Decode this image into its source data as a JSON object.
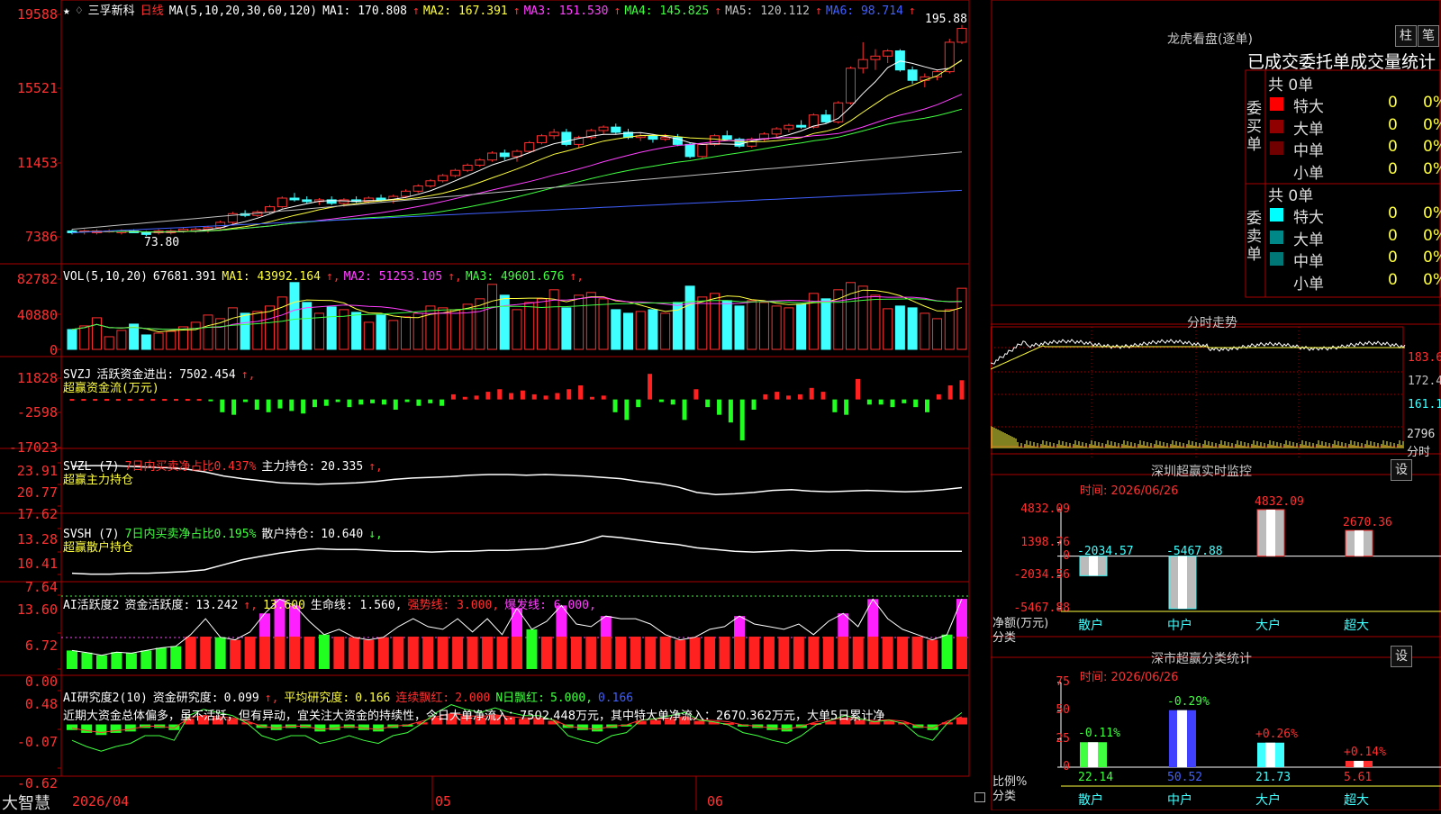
{
  "main": {
    "star": "★",
    "mark": "♢",
    "stock_name": "三孚新科",
    "period": "日线",
    "ma_label": "MA(5,10,20,30,60,120)",
    "ma": [
      {
        "name": "MA1:",
        "value": "170.808",
        "arrow": "↑",
        "color": "#ffffff"
      },
      {
        "name": "MA2:",
        "value": "167.391",
        "arrow": "↑",
        "color": "#ffff40"
      },
      {
        "name": "MA3:",
        "value": "151.530",
        "arrow": "↑",
        "color": "#ff40ff"
      },
      {
        "name": "MA4:",
        "value": "145.825",
        "arrow": "↑",
        "color": "#40ff40"
      },
      {
        "name": "MA5:",
        "value": "120.112",
        "arrow": "↑",
        "color": "#c0c0c0"
      },
      {
        "name": "MA6:",
        "value": "98.714",
        "arrow": "↑",
        "color": "#4060ff"
      }
    ],
    "price_axis": [
      "19588",
      "15521",
      "11453",
      "7386"
    ],
    "high_label": "195.88",
    "low_label": "73.80",
    "vol": {
      "label": "VOL(5,10,20)",
      "value": "67681.391",
      "ma": [
        {
          "name": "MA1:",
          "value": "43992.164",
          "color": "#ffff40"
        },
        {
          "name": "MA2:",
          "value": "51253.105",
          "color": "#ff40ff"
        },
        {
          "name": "MA3:",
          "value": "49601.676",
          "color": "#40ff40"
        }
      ],
      "axis": [
        "82782",
        "40880",
        "0"
      ]
    },
    "svzj": {
      "label": "SVZJ",
      "name": "活跃资金进出:",
      "value": "7502.454",
      "sub": "超赢资金流(万元)",
      "axis": [
        "11828",
        "-2598",
        "-17023"
      ]
    },
    "svzl": {
      "label": "SVZL (7)",
      "name1": "7日内买卖净占比0.437%",
      "name2": "主力持仓:",
      "value": "20.335",
      "sub": "超赢主力持仓",
      "axis": [
        "23.91",
        "20.77",
        "17.62"
      ]
    },
    "svsh": {
      "label": "SVSH (7)",
      "name1": "7日内买卖净占比0.195%",
      "name2": "散户持仓:",
      "value": "10.640",
      "sub": "超赢散户持仓",
      "axis": [
        "13.28",
        "10.41",
        "7.64"
      ]
    },
    "ai1": {
      "label": "AI活跃度2",
      "name": "资金活跃度:",
      "value": "13.242",
      "v2": "13.600",
      "life": "生命线: 1.560,",
      "strong": "强势线: 3.000,",
      "burst": "爆发线: 6.000,",
      "axis": [
        "13.60",
        "6.72",
        "0.00"
      ]
    },
    "ai2": {
      "label": "AI研究度2(10)",
      "name": "资金研究度:",
      "value": "0.099",
      "avg": "平均研究度:",
      "avg_value": "0.166",
      "cont": "连续飘红:",
      "cont_value": "2.000",
      "nday": "N日飘红:",
      "nday_value": "5.000,",
      "last": "0.166",
      "text": "近期大资金总体偏多，虽不活跃，但有异动，宜关注大资金的持续性，今日大单净流入：7502.448万元，其中特大单净流入：2670.362万元，大单5日累计净",
      "axis": [
        "0.48",
        "-0.07",
        "-0.62"
      ]
    },
    "footer": {
      "brand": "大智慧",
      "d1": "2026/04",
      "d2": "05",
      "d3": "06"
    }
  },
  "right": {
    "lhb_title": "龙虎看盘(逐单)",
    "btn_zhu": "柱",
    "btn_bi": "笔",
    "tabs_title": "已成交委托单成交量统计",
    "buy_group": "委买单",
    "sell_group": "委卖单",
    "buy_total": "共 0单",
    "sell_total": "共 0单",
    "buy_rows": [
      {
        "name": "特大",
        "count": "0",
        "pct": "0%",
        "color": "#ff0000"
      },
      {
        "name": "大单",
        "count": "0",
        "pct": "0%",
        "color": "#900000"
      },
      {
        "name": "中单",
        "count": "0",
        "pct": "0%",
        "color": "#700000"
      },
      {
        "name": "小单",
        "count": "0",
        "pct": "0%",
        "color": ""
      }
    ],
    "sell_rows": [
      {
        "name": "特大",
        "count": "0",
        "pct": "0%",
        "color": "#00ffff"
      },
      {
        "name": "大单",
        "count": "0",
        "pct": "0%",
        "color": "#008888"
      },
      {
        "name": "中单",
        "count": "0",
        "pct": "0%",
        "color": "#007777"
      },
      {
        "name": "小单",
        "count": "0",
        "pct": "0%",
        "color": ""
      }
    ],
    "intraday_title": "分时走势",
    "intraday_axis": [
      "183.6",
      "172.4",
      "161.1"
    ],
    "intraday_vol": "2796",
    "intraday_vol_unit": "分时",
    "sz_title": "深圳超赢实时监控",
    "sz_btn": "设",
    "sz_time": "时间: 2026/06/26",
    "sz_axis": [
      "4832.09",
      "1398.76",
      "0",
      "-2034.56",
      "-5467.88"
    ],
    "sz_ylabel1": "净额(万元)",
    "sz_ylabel2": "分类",
    "sz_cats": [
      "散户",
      "中户",
      "大户",
      "超大"
    ],
    "sz_values": [
      "-2034.57",
      "-5467.88",
      "4832.09",
      "2670.36"
    ],
    "cls_title": "深市超赢分类统计",
    "cls_btn": "设",
    "cls_time": "时间: 2026/06/26",
    "cls_axis": [
      "75",
      "50",
      "25",
      "0"
    ],
    "cls_ylabel1": "比例%",
    "cls_ylabel2": "分类",
    "cls_cats": [
      "散户",
      "中户",
      "大户",
      "超大"
    ],
    "cls_values": [
      "22.14",
      "50.52",
      "21.73",
      "5.61"
    ],
    "cls_changes": [
      "-0.11%",
      "-0.29%",
      "+0.26%",
      "+0.14%"
    ]
  },
  "chart_data": [
    {
      "type": "candlestick",
      "title": "三孚新科 日线",
      "ylim": [
        7386,
        19588
      ],
      "candles": [
        [
          77,
          78,
          75,
          76
        ],
        [
          77,
          78,
          75,
          77
        ],
        [
          76,
          78,
          75,
          77
        ],
        [
          77,
          78,
          76,
          77
        ],
        [
          76,
          78,
          75,
          77
        ],
        [
          77,
          78,
          76,
          76
        ],
        [
          76,
          77,
          74,
          75
        ],
        [
          76,
          78,
          75,
          77
        ],
        [
          76,
          78,
          75,
          77
        ],
        [
          77,
          79,
          76,
          78
        ],
        [
          77,
          79,
          76,
          78
        ],
        [
          78,
          80,
          76,
          79
        ],
        [
          79,
          83,
          78,
          82
        ],
        [
          82,
          88,
          81,
          87
        ],
        [
          87,
          89,
          85,
          86
        ],
        [
          86,
          89,
          85,
          88
        ],
        [
          88,
          92,
          87,
          91
        ],
        [
          91,
          97,
          90,
          96
        ],
        [
          96,
          99,
          94,
          95
        ],
        [
          95,
          97,
          93,
          94
        ],
        [
          94,
          96,
          92,
          95
        ],
        [
          95,
          97,
          92,
          93
        ],
        [
          93,
          96,
          91,
          95
        ],
        [
          95,
          97,
          93,
          94
        ],
        [
          94,
          97,
          93,
          96
        ],
        [
          96,
          98,
          94,
          95
        ],
        [
          95,
          98,
          93,
          97
        ],
        [
          97,
          101,
          96,
          100
        ],
        [
          100,
          104,
          99,
          103
        ],
        [
          103,
          107,
          102,
          106
        ],
        [
          106,
          110,
          105,
          109
        ],
        [
          109,
          113,
          108,
          112
        ],
        [
          112,
          116,
          111,
          115
        ],
        [
          115,
          119,
          114,
          118
        ],
        [
          118,
          123,
          117,
          122
        ],
        [
          122,
          124,
          118,
          120
        ],
        [
          120,
          124,
          117,
          123
        ],
        [
          123,
          129,
          122,
          128
        ],
        [
          128,
          133,
          127,
          132
        ],
        [
          132,
          136,
          130,
          134
        ],
        [
          134,
          136,
          126,
          127
        ],
        [
          127,
          132,
          125,
          131
        ],
        [
          131,
          136,
          130,
          135
        ],
        [
          135,
          138,
          133,
          137
        ],
        [
          137,
          139,
          133,
          134
        ],
        [
          134,
          136,
          130,
          131
        ],
        [
          131,
          134,
          129,
          132
        ],
        [
          132,
          133,
          128,
          130
        ],
        [
          130,
          133,
          129,
          131
        ],
        [
          131,
          133,
          126,
          127
        ],
        [
          127,
          128,
          119,
          120
        ],
        [
          120,
          128,
          119,
          127
        ],
        [
          127,
          133,
          126,
          132
        ],
        [
          132,
          135,
          129,
          130
        ],
        [
          130,
          131,
          125,
          126
        ],
        [
          126,
          131,
          125,
          130
        ],
        [
          130,
          134,
          129,
          133
        ],
        [
          133,
          137,
          131,
          136
        ],
        [
          136,
          139,
          134,
          138
        ],
        [
          138,
          141,
          136,
          137
        ],
        [
          137,
          145,
          136,
          144
        ],
        [
          144,
          147,
          139,
          140
        ],
        [
          140,
          152,
          139,
          151
        ],
        [
          151,
          172,
          150,
          171
        ],
        [
          171,
          186,
          168,
          176
        ],
        [
          176,
          182,
          170,
          178
        ],
        [
          178,
          182,
          174,
          181
        ],
        [
          181,
          182,
          169,
          170
        ],
        [
          170,
          172,
          162,
          164
        ],
        [
          164,
          168,
          160,
          166
        ],
        [
          166,
          170,
          164,
          169
        ],
        [
          169,
          188,
          168,
          186
        ],
        [
          186,
          196,
          185,
          194
        ]
      ]
    },
    {
      "type": "bar",
      "title": "VOL(5,10,20)",
      "ylim": [
        0,
        82782
      ],
      "values": [
        22000,
        26000,
        35000,
        14000,
        21000,
        28000,
        16000,
        18000,
        20000,
        25000,
        30000,
        38000,
        34000,
        46000,
        40000,
        42000,
        48000,
        58000,
        74000,
        52000,
        40000,
        47000,
        44000,
        41000,
        30000,
        38000,
        32000,
        36000,
        40000,
        48000,
        46000,
        44000,
        50000,
        56000,
        72000,
        60000,
        44000,
        52000,
        56000,
        66000,
        46000,
        60000,
        63000,
        56000,
        44000,
        40000,
        42000,
        44000,
        40000,
        52000,
        70000,
        58000,
        62000,
        54000,
        48000,
        54000,
        52000,
        48000,
        46000,
        50000,
        62000,
        56000,
        66000,
        74000,
        70000,
        60000,
        45000,
        48000,
        46000,
        40000,
        34000,
        44000,
        67681
      ]
    },
    {
      "type": "bar",
      "title": "SVZJ 超赢资金流(万元)",
      "ylim": [
        -17023,
        11828
      ],
      "values": [
        200,
        200,
        200,
        200,
        200,
        200,
        200,
        200,
        200,
        200,
        200,
        200,
        -500,
        -5000,
        -6000,
        -1000,
        -4000,
        -5000,
        -3500,
        -4500,
        -5500,
        -3000,
        -2500,
        -1000,
        -3000,
        -2000,
        -1500,
        -2000,
        -4000,
        -1000,
        -2500,
        -1500,
        -2500,
        2000,
        1000,
        1500,
        3000,
        4000,
        2500,
        3500,
        2000,
        1500,
        2500,
        4000,
        5500,
        1000,
        1500,
        -5000,
        -8000,
        -3000,
        10000,
        -1000,
        -2000,
        -8000,
        4000,
        -3000,
        -6000,
        -9000,
        -16000,
        -4000,
        2000,
        3000,
        1500,
        2000,
        4500,
        3000,
        -5000,
        -6000,
        8000,
        -2000,
        -2000,
        -3000,
        -1500,
        -3000,
        -5000,
        2000,
        5500,
        7502
      ]
    },
    {
      "type": "line",
      "title": "SVZL 超赢主力持仓",
      "ylim": [
        17.62,
        23.91
      ],
      "values": [
        23.4,
        23.5,
        23.5,
        23.4,
        23.3,
        23.2,
        23.0,
        22.6,
        22.0,
        21.6,
        21.3,
        21.0,
        20.9,
        20.8,
        20.9,
        21.0,
        21.2,
        21.5,
        21.7,
        21.8,
        21.9,
        22.1,
        22.2,
        22.2,
        22.1,
        22.2,
        22.1,
        22.0,
        21.8,
        21.6,
        21.2,
        20.9,
        20.4,
        19.6,
        19.3,
        19.4,
        19.6,
        19.9,
        20.0,
        19.8,
        19.7,
        19.8,
        19.9,
        19.8,
        19.7,
        19.8,
        20.0,
        20.3
      ]
    },
    {
      "type": "line",
      "title": "SVSH 超赢散户持仓",
      "ylim": [
        7.64,
        13.28
      ],
      "values": [
        8.0,
        7.9,
        7.9,
        8.0,
        8.0,
        8.1,
        8.2,
        8.4,
        9.0,
        9.6,
        10.0,
        10.4,
        10.7,
        10.9,
        10.8,
        10.8,
        10.7,
        10.6,
        10.6,
        10.5,
        10.6,
        10.6,
        10.7,
        10.7,
        10.8,
        10.9,
        11.3,
        11.7,
        12.4,
        12.2,
        11.9,
        11.6,
        11.4,
        11.0,
        10.8,
        10.6,
        10.5,
        10.6,
        10.7,
        10.6,
        10.7,
        10.7,
        10.6,
        10.6,
        10.6,
        10.6,
        10.6,
        10.6
      ]
    },
    {
      "type": "bar",
      "title": "AI活跃度2",
      "ylim": [
        0,
        13.6
      ],
      "values": [
        3.5,
        3.1,
        2.6,
        3.2,
        3.0,
        3.5,
        4.0,
        4.3,
        6.5,
        9.5,
        6.0,
        5.5,
        7.0,
        10.5,
        13.2,
        12.0,
        9.0,
        6.5,
        7.5,
        6.0,
        5.5,
        6.0,
        8.0,
        9.5,
        8.0,
        7.5,
        9.5,
        7.0,
        9.5,
        6.5,
        11.5,
        7.5,
        9.0,
        12.0,
        8.5,
        8.0,
        10.0,
        9.5,
        9.5,
        8.5,
        6.5,
        5.5,
        6.0,
        7.5,
        8.0,
        10.0,
        8.5,
        8.0,
        7.5,
        8.5,
        6.5,
        9.0,
        10.5,
        8.0,
        13.2,
        9.5,
        7.5,
        6.5,
        5.5,
        6.5,
        13.24
      ]
    },
    {
      "type": "bar",
      "title": "AI研究度2(10)",
      "ylim": [
        -0.62,
        0.48
      ],
      "values": [
        -0.08,
        -0.12,
        -0.15,
        -0.12,
        -0.1,
        -0.05,
        -0.05,
        -0.08,
        0.08,
        0.12,
        0.1,
        0.08,
        0.03,
        -0.05,
        -0.08,
        -0.05,
        -0.05,
        -0.1,
        -0.08,
        -0.05,
        -0.08,
        -0.1,
        -0.05,
        -0.03,
        0.03,
        0.1,
        0.15,
        0.12,
        0.1,
        0.13,
        0.1,
        0.08,
        0.08,
        0.05,
        -0.05,
        -0.08,
        -0.1,
        -0.05,
        -0.03,
        0.05,
        0.06,
        0.08,
        0.1,
        0.05,
        0.04,
        0.02,
        -0.03,
        -0.05,
        -0.08,
        -0.1,
        -0.05,
        0.02,
        0.05,
        0.08,
        0.06,
        0.04,
        0.05,
        0.03,
        -0.05,
        -0.08,
        0.03,
        0.099
      ]
    },
    {
      "type": "bar",
      "title": "深圳超赢实时监控",
      "categories": [
        "散户",
        "中户",
        "大户",
        "超大"
      ],
      "values": [
        -2034.57,
        -5467.88,
        4832.09,
        2670.36
      ],
      "ylim": [
        -5467.88,
        4832.09
      ],
      "xlabel": "分类",
      "ylabel": "净额(万元)"
    },
    {
      "type": "bar",
      "title": "深市超赢分类统计",
      "categories": [
        "散户",
        "中户",
        "大户",
        "超大"
      ],
      "values": [
        22.14,
        50.52,
        21.73,
        5.61
      ],
      "ylim": [
        0,
        75
      ],
      "xlabel": "分类",
      "ylabel": "比例%"
    }
  ]
}
